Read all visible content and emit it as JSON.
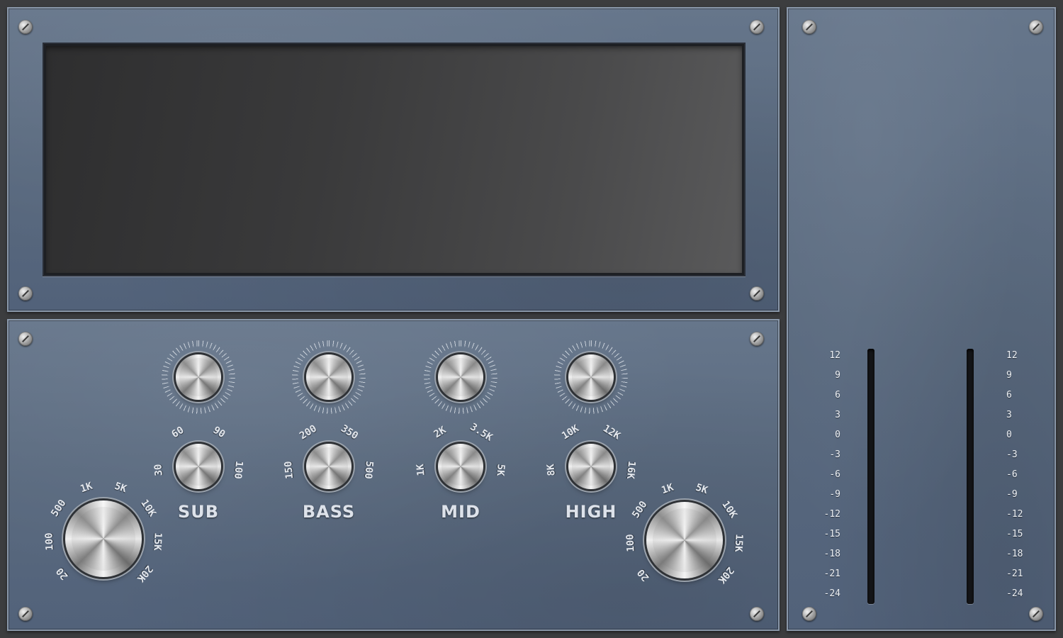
{
  "display": {},
  "controls": {
    "freq_left": [
      "20",
      "100",
      "500",
      "1K",
      "5K",
      "10K",
      "15K",
      "20K"
    ],
    "freq_right": [
      "20",
      "100",
      "500",
      "1K",
      "5K",
      "10K",
      "15K",
      "20K"
    ],
    "bands": [
      {
        "label": "SUB",
        "scale": [
          "30",
          "60",
          "90",
          "100"
        ]
      },
      {
        "label": "BASS",
        "scale": [
          "150",
          "200",
          "350",
          "500"
        ]
      },
      {
        "label": "MID",
        "scale": [
          "1K",
          "2K",
          "3.5K",
          "5K"
        ]
      },
      {
        "label": "HIGH",
        "scale": [
          "8K",
          "10K",
          "12K",
          "16K"
        ]
      }
    ]
  },
  "meters": {
    "scale": [
      "12",
      "9",
      "6",
      "3",
      "0",
      "-3",
      "-6",
      "-9",
      "-12",
      "-15",
      "-18",
      "-21",
      "-24"
    ]
  },
  "colors": {
    "plate": "#5a6a7f",
    "screen": "#3a3a3b",
    "label": "#dde2ea"
  }
}
